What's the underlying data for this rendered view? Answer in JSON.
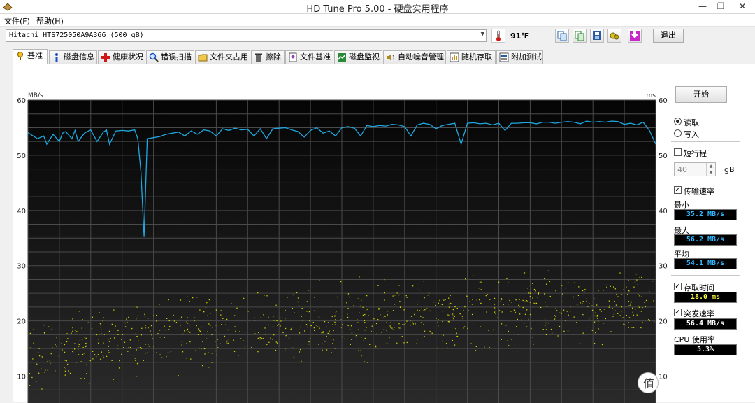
{
  "window": {
    "title": "HD Tune Pro 5.00 - 硬盘实用程序",
    "min_glyph": "—",
    "max_glyph": "❐",
    "close_glyph": "✕"
  },
  "menu": [
    "文件(F)",
    "帮助(H)"
  ],
  "toolbar": {
    "drive": "Hitachi HTS725050A9A366  (500 gB)",
    "temperature": "91℉",
    "exit_label": "退出",
    "buttons": [
      "copy-info-icon",
      "copy-text-icon",
      "save-icon",
      "options-icon",
      "download-icon"
    ]
  },
  "tabs": [
    {
      "label": "基准",
      "icon": "benchmark-icon",
      "active": true
    },
    {
      "label": "磁盘信息",
      "icon": "info-icon"
    },
    {
      "label": "健康状况",
      "icon": "health-cross-icon"
    },
    {
      "label": "错误扫描",
      "icon": "magnifier-icon"
    },
    {
      "label": "文件夹占用",
      "icon": "folder-icon"
    },
    {
      "label": "擦除",
      "icon": "trash-icon"
    },
    {
      "label": "文件基准",
      "icon": "file-benchmark-icon"
    },
    {
      "label": "磁盘监视",
      "icon": "monitor-icon"
    },
    {
      "label": "自动噪音管理",
      "icon": "speaker-icon"
    },
    {
      "label": "随机存取",
      "icon": "random-access-icon"
    },
    {
      "label": "附加测试",
      "icon": "extra-tests-icon"
    }
  ],
  "side": {
    "start_label": "开始",
    "read_label": "读取",
    "write_label": "写入",
    "read_selected": true,
    "short_stroke_label": "短行程",
    "short_stroke_checked": false,
    "short_stroke_value": "40",
    "short_stroke_unit": "gB",
    "transfer_rate_label": "传输速率",
    "transfer_rate_checked": true,
    "min_label": "最小",
    "min_value": "35.2 MB/s",
    "max_label": "最大",
    "max_value": "56.2 MB/s",
    "avg_label": "平均",
    "avg_value": "54.1 MB/s",
    "access_time_label": "存取时间",
    "access_time_checked": true,
    "access_time_value": "18.0 ms",
    "burst_rate_label": "突发速率",
    "burst_rate_checked": true,
    "burst_rate_value": "56.4 MB/s",
    "cpu_label": "CPU 使用率",
    "cpu_value": "5.3%"
  },
  "chart_data": {
    "type": "line",
    "left_unit": "MB/s",
    "right_unit": "ms",
    "y_ticks": [
      10,
      20,
      30,
      40,
      50,
      60
    ],
    "ylim": [
      5,
      60
    ],
    "xlim": [
      0,
      100
    ],
    "grid": true,
    "series": [
      {
        "name": "传输速率",
        "color": "#1fa8e0",
        "x": [
          0,
          1.5,
          2.5,
          3,
          4,
          5,
          5.5,
          6,
          7,
          7.5,
          8,
          9,
          10,
          11,
          12,
          12.5,
          13,
          14,
          15,
          16,
          17,
          17.5,
          18,
          18.5,
          19,
          20,
          21,
          22,
          23,
          24,
          25,
          26,
          27,
          28,
          29,
          30,
          31,
          32,
          33,
          34,
          35,
          36,
          37,
          38,
          39,
          40,
          41,
          42,
          43,
          44,
          45,
          46,
          47,
          48,
          49,
          50,
          51,
          52,
          53,
          54,
          55,
          56,
          57,
          58,
          59,
          60,
          61,
          62,
          63,
          64,
          65,
          66,
          67,
          68,
          69,
          70,
          71,
          72,
          73,
          74,
          75,
          76,
          77,
          78,
          79,
          80,
          81,
          82,
          83,
          84,
          85,
          86,
          87,
          88,
          89,
          90,
          91,
          92,
          93,
          94,
          95,
          96,
          97,
          98,
          99,
          100
        ],
        "values": [
          54.1,
          53,
          53.5,
          52,
          53.8,
          52.5,
          54,
          54.3,
          53,
          54.5,
          52.5,
          54,
          54.6,
          52.5,
          54.2,
          54.6,
          52,
          54.4,
          54.5,
          54.4,
          54.6,
          53,
          47,
          35.2,
          53,
          53.2,
          53.4,
          53.8,
          54,
          54.2,
          53.5,
          54.4,
          53.8,
          54.6,
          54.4,
          53.5,
          54.8,
          54.5,
          54.9,
          54.6,
          54.7,
          53.5,
          54.8,
          53,
          54.8,
          54.9,
          55,
          54.6,
          54.3,
          53.3,
          54.5,
          55,
          54,
          54.4,
          53.5,
          55,
          55.2,
          54.9,
          53.5,
          55.4,
          55.2,
          55.4,
          55.3,
          55.6,
          55.5,
          55.2,
          53.5,
          55.5,
          55.8,
          55.6,
          54.8,
          55.4,
          55.6,
          55.8,
          52,
          55.8,
          55.9,
          55.7,
          55.8,
          55.5,
          55.8,
          54.5,
          55.8,
          55.8,
          55.9,
          55.9,
          55.7,
          56,
          56,
          55.8,
          56,
          56.1,
          56,
          55.7,
          56.2,
          56,
          56.1,
          56,
          56.2,
          56.1,
          55.6,
          55.8,
          55.5,
          56,
          54.5,
          52
        ]
      },
      {
        "name": "存取时间",
        "color": "#d4d400",
        "trend_x": [
          0,
          10,
          20,
          30,
          40,
          50,
          60,
          70,
          80,
          90,
          100
        ],
        "trend_values": [
          13.5,
          15.5,
          17,
          18,
          19,
          20,
          20.8,
          21.5,
          22,
          22.5,
          23
        ]
      }
    ]
  }
}
